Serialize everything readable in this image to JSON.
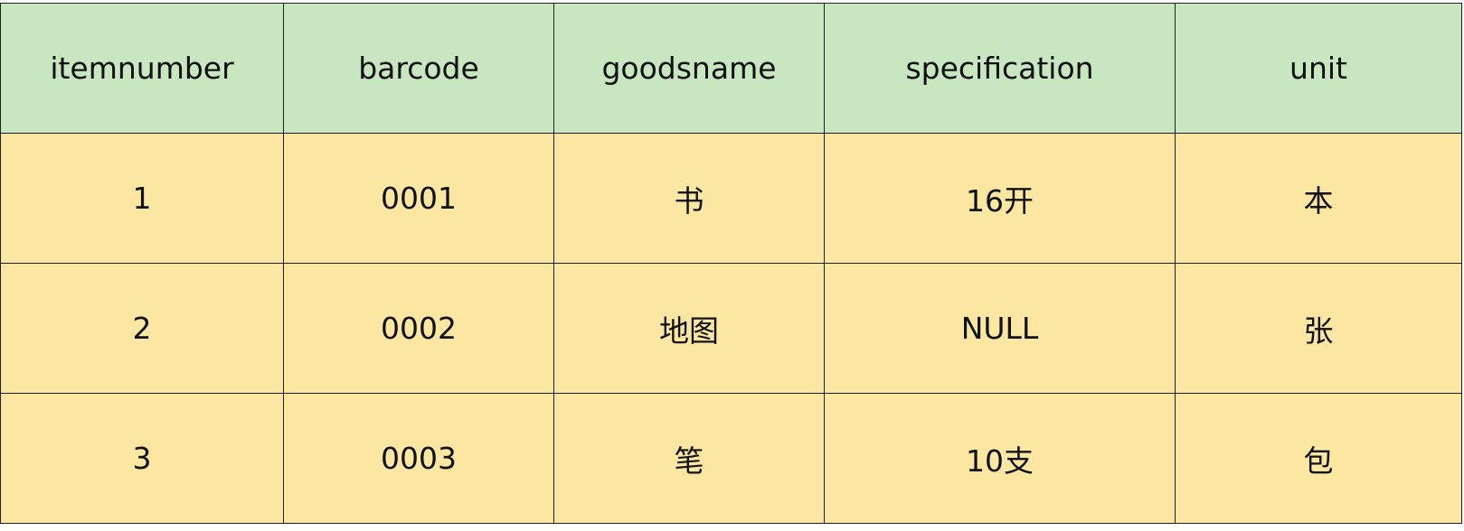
{
  "table": {
    "header_bg": "#c8e6c0",
    "row_bg": "#fbe7a1",
    "border_color": "#1f1f1f",
    "columns": [
      "itemnumber",
      "barcode",
      "goodsname",
      "specification",
      "unit"
    ],
    "rows": [
      [
        "1",
        "0001",
        "书",
        "16开",
        "本"
      ],
      [
        "2",
        "0002",
        "地图",
        "NULL",
        "张"
      ],
      [
        "3",
        "0003",
        "笔",
        "10支",
        "包"
      ]
    ]
  }
}
